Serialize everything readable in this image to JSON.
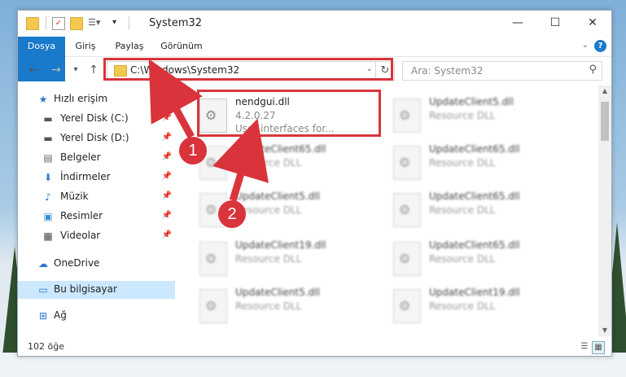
{
  "window": {
    "title": "System32",
    "controls": {
      "minimize": "—",
      "maximize": "☐",
      "close": "✕"
    }
  },
  "ribbon": {
    "tabs": [
      {
        "label": "Dosya",
        "active": true
      },
      {
        "label": "Giriş"
      },
      {
        "label": "Paylaş"
      },
      {
        "label": "Görünüm"
      }
    ],
    "help": "?"
  },
  "nav": {
    "back": "←",
    "forward": "→",
    "recent": "▾",
    "up": "↑",
    "address": "C:\\Windows\\System32",
    "refresh": "↻",
    "search_placeholder": "Ara: System32"
  },
  "sidebar": {
    "items": [
      {
        "label": "Hızlı erişim",
        "icon": "star-icon",
        "pinned": false
      },
      {
        "label": "Yerel Disk (C:)",
        "icon": "drive-icon",
        "pinned": true
      },
      {
        "label": "Yerel Disk (D:)",
        "icon": "drive-icon",
        "pinned": true
      },
      {
        "label": "Belgeler",
        "icon": "document-icon",
        "pinned": true
      },
      {
        "label": "İndirmeler",
        "icon": "download-icon",
        "pinned": true
      },
      {
        "label": "Müzik",
        "icon": "music-icon",
        "pinned": true
      },
      {
        "label": "Resimler",
        "icon": "pictures-icon",
        "pinned": true
      },
      {
        "label": "Videolar",
        "icon": "video-icon",
        "pinned": true
      },
      {
        "label": "OneDrive",
        "icon": "cloud-icon",
        "pinned": false
      },
      {
        "label": "Bu bilgisayar",
        "icon": "computer-icon",
        "pinned": false,
        "selected": true
      },
      {
        "label": "Ağ",
        "icon": "network-icon",
        "pinned": false
      }
    ]
  },
  "files": {
    "highlight": {
      "name": "nendgui.dll",
      "version": "4.2.0.27",
      "description": "User interfaces for..."
    },
    "left": [
      {
        "name": "UpdateClient65.dll",
        "type": "Resource DLL"
      },
      {
        "name": "UpdateClient5.dll",
        "type": "Resource DLL"
      },
      {
        "name": "UpdateClient19.dll",
        "type": "Resource DLL"
      },
      {
        "name": "UpdateClient5.dll",
        "type": "Resource DLL"
      }
    ],
    "right": [
      {
        "name": "UpdateClient5.dll",
        "type": "Resource DLL"
      },
      {
        "name": "UpdateClient65.dll",
        "type": "Resource DLL"
      },
      {
        "name": "UpdateClient65.dll",
        "type": "Resource DLL"
      },
      {
        "name": "UpdateClient65.dll",
        "type": "Resource DLL"
      },
      {
        "name": "UpdateClient19.dll",
        "type": "Resource DLL"
      }
    ]
  },
  "status": {
    "count": "102 öğe"
  },
  "markers": {
    "one": "1",
    "two": "2"
  },
  "colors": {
    "accent": "#1979ca",
    "annotation": "#d9343b",
    "selection": "#cce8ff"
  }
}
